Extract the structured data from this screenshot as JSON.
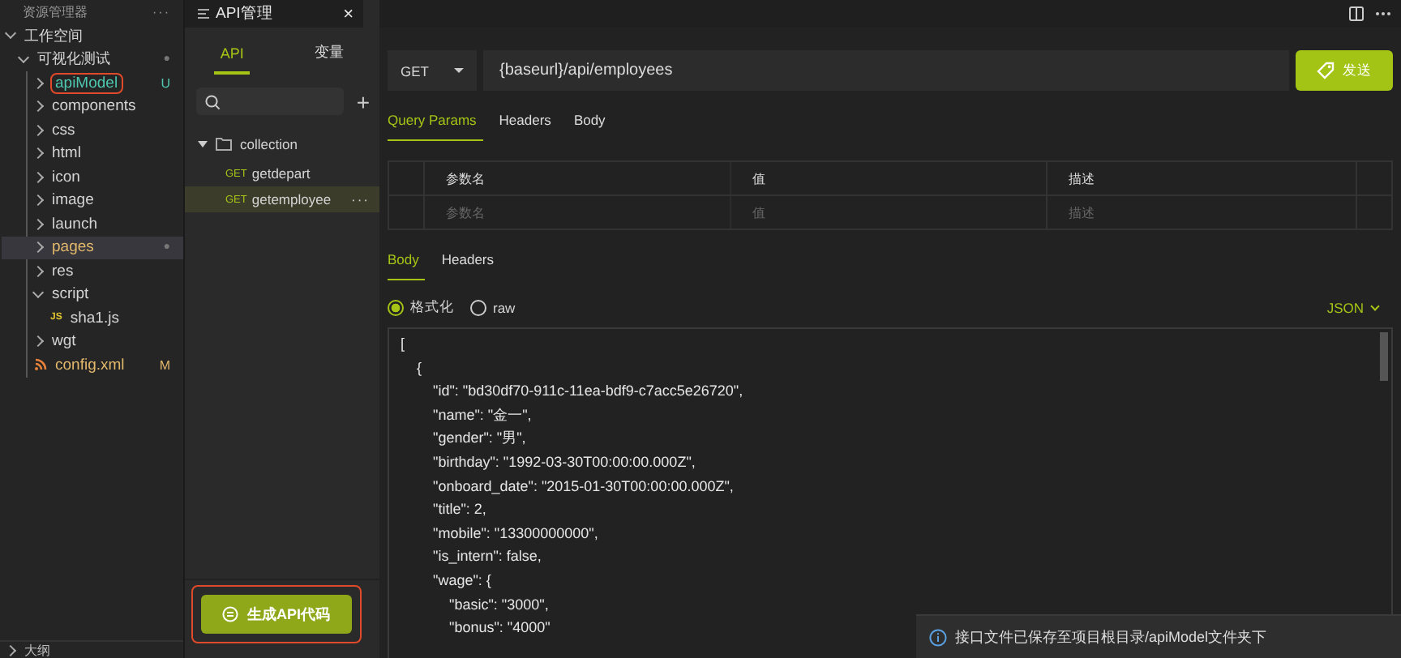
{
  "explorer": {
    "title": "资源管理器",
    "more": "···",
    "workspace": {
      "label": "工作空间",
      "expanded": true,
      "children": [
        {
          "label": "可视化测试",
          "expanded": true,
          "badge": "●",
          "children": [
            {
              "label": "apiModel",
              "kind": "folder",
              "expanded": false,
              "color": "#4ec9b0",
              "badge": "U",
              "annotated": true,
              "selected": false
            },
            {
              "label": "components",
              "kind": "folder",
              "expanded": false,
              "color": "#d4d4d4",
              "selected": false
            },
            {
              "label": "css",
              "kind": "folder",
              "expanded": false,
              "color": "#d4d4d4",
              "selected": false
            },
            {
              "label": "html",
              "kind": "folder",
              "expanded": false,
              "color": "#d4d4d4",
              "selected": false
            },
            {
              "label": "icon",
              "kind": "folder",
              "expanded": false,
              "color": "#d4d4d4",
              "selected": false
            },
            {
              "label": "image",
              "kind": "folder",
              "expanded": false,
              "color": "#d4d4d4",
              "selected": false
            },
            {
              "label": "launch",
              "kind": "folder",
              "expanded": false,
              "color": "#d4d4d4",
              "selected": false
            },
            {
              "label": "pages",
              "kind": "folder",
              "expanded": false,
              "color": "#e2b86b",
              "badge": "●",
              "selected": true
            },
            {
              "label": "res",
              "kind": "folder",
              "expanded": false,
              "color": "#d4d4d4",
              "selected": false
            },
            {
              "label": "script",
              "kind": "folder",
              "expanded": true,
              "color": "#d4d4d4",
              "selected": false,
              "children": [
                {
                  "label": "sha1.js",
                  "kind": "js",
                  "icon_text": "JS",
                  "color": "#d4d4d4",
                  "selected": false
                }
              ]
            },
            {
              "label": "wgt",
              "kind": "folder",
              "expanded": false,
              "color": "#d4d4d4",
              "selected": false
            },
            {
              "label": "config.xml",
              "kind": "xml",
              "color": "#e2b86b",
              "badge": "M",
              "selected": false
            }
          ]
        }
      ]
    },
    "outline": {
      "label": "大纲",
      "expanded": false
    }
  },
  "editor_tab": {
    "title": "API管理",
    "close": "×"
  },
  "api_panel": {
    "tabs": [
      {
        "label": "API",
        "selected": true
      },
      {
        "label": "变量",
        "selected": false
      }
    ],
    "add": "+",
    "collection": {
      "label": "collection",
      "expanded": true,
      "requests": [
        {
          "method": "GET",
          "name": "getdepart",
          "selected": false
        },
        {
          "method": "GET",
          "name": "getemployee",
          "selected": true,
          "more": "···"
        }
      ]
    },
    "generate_button": {
      "label": "生成API代码",
      "annotated": true
    }
  },
  "request": {
    "method": "GET",
    "url": "{baseurl}/api/employees",
    "send": "发送",
    "param_tabs": [
      {
        "label": "Query Params",
        "selected": true
      },
      {
        "label": "Headers",
        "selected": false
      },
      {
        "label": "Body",
        "selected": false
      }
    ],
    "params_table": {
      "columns": [
        "参数名",
        "值",
        "描述"
      ],
      "placeholders": [
        "参数名",
        "值",
        "描述"
      ]
    }
  },
  "response": {
    "tabs": [
      {
        "label": "Body",
        "selected": true
      },
      {
        "label": "Headers",
        "selected": false
      }
    ],
    "formats": [
      {
        "label": "格式化",
        "selected": true
      },
      {
        "label": "raw",
        "selected": false
      }
    ],
    "language": "JSON",
    "lines": [
      "[",
      "    {",
      "        \"id\": \"bd30df70-911c-11ea-bdf9-c7acc5e26720\",",
      "        \"name\": \"金一\",",
      "        \"gender\": \"男\",",
      "        \"birthday\": \"1992-03-30T00:00:00.000Z\",",
      "        \"onboard_date\": \"2015-01-30T00:00:00.000Z\",",
      "        \"title\": 2,",
      "        \"mobile\": \"13300000000\",",
      "        \"is_intern\": false,",
      "        \"wage\": {",
      "            \"basic\": \"3000\",",
      "            \"bonus\": \"4000\""
    ]
  },
  "notification": {
    "text": "接口文件已保存至项目根目录/apiModel文件夹下"
  }
}
